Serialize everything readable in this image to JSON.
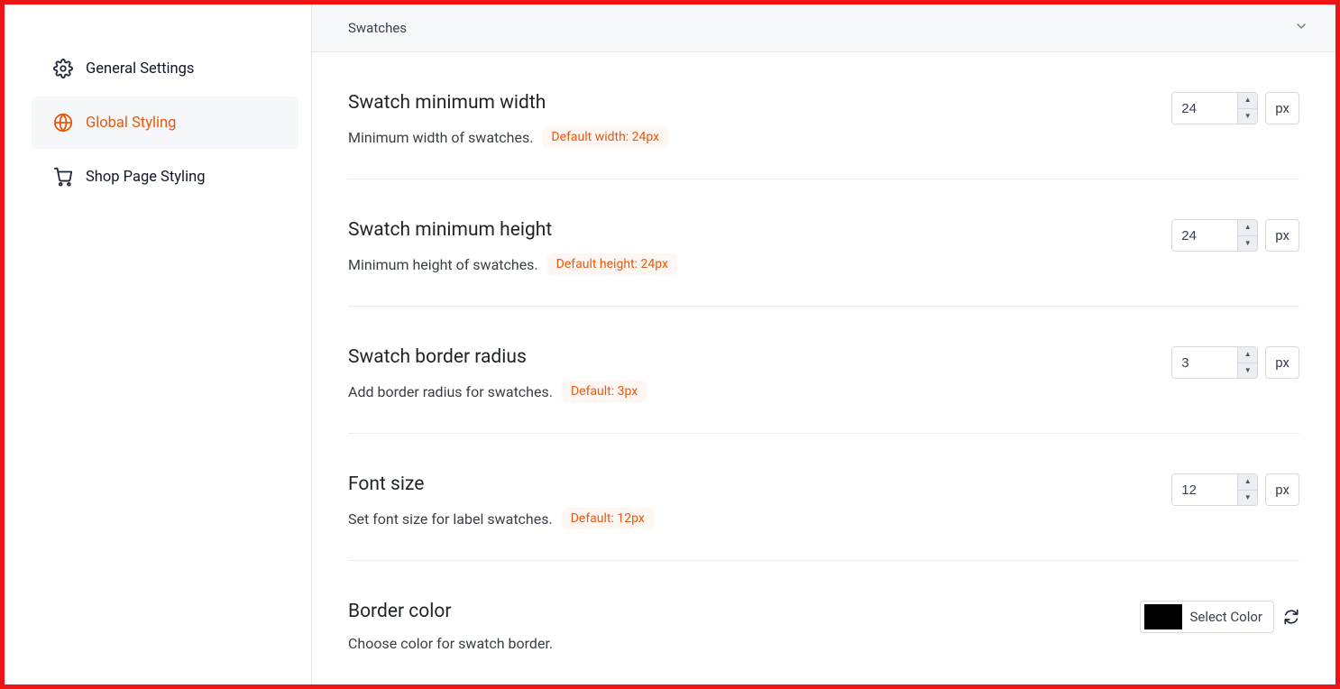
{
  "sidebar": {
    "items": [
      {
        "label": "General Settings"
      },
      {
        "label": "Global Styling"
      },
      {
        "label": "Shop Page Styling"
      }
    ]
  },
  "accordion": {
    "title": "Swatches"
  },
  "rows": {
    "min_width": {
      "title": "Swatch minimum width",
      "desc": "Minimum width of swatches.",
      "default_badge": "Default width: 24px",
      "value": "24",
      "unit": "px"
    },
    "min_height": {
      "title": "Swatch minimum height",
      "desc": "Minimum height of swatches.",
      "default_badge": "Default height: 24px",
      "value": "24",
      "unit": "px"
    },
    "border_radius": {
      "title": "Swatch border radius",
      "desc": "Add border radius for swatches.",
      "default_badge": "Default: 3px",
      "value": "3",
      "unit": "px"
    },
    "font_size": {
      "title": "Font size",
      "desc": "Set font size for label swatches.",
      "default_badge": "Default: 12px",
      "value": "12",
      "unit": "px"
    },
    "border_color": {
      "title": "Border color",
      "desc": "Choose color for swatch border.",
      "value": "#000000",
      "select_label": "Select Color"
    }
  }
}
